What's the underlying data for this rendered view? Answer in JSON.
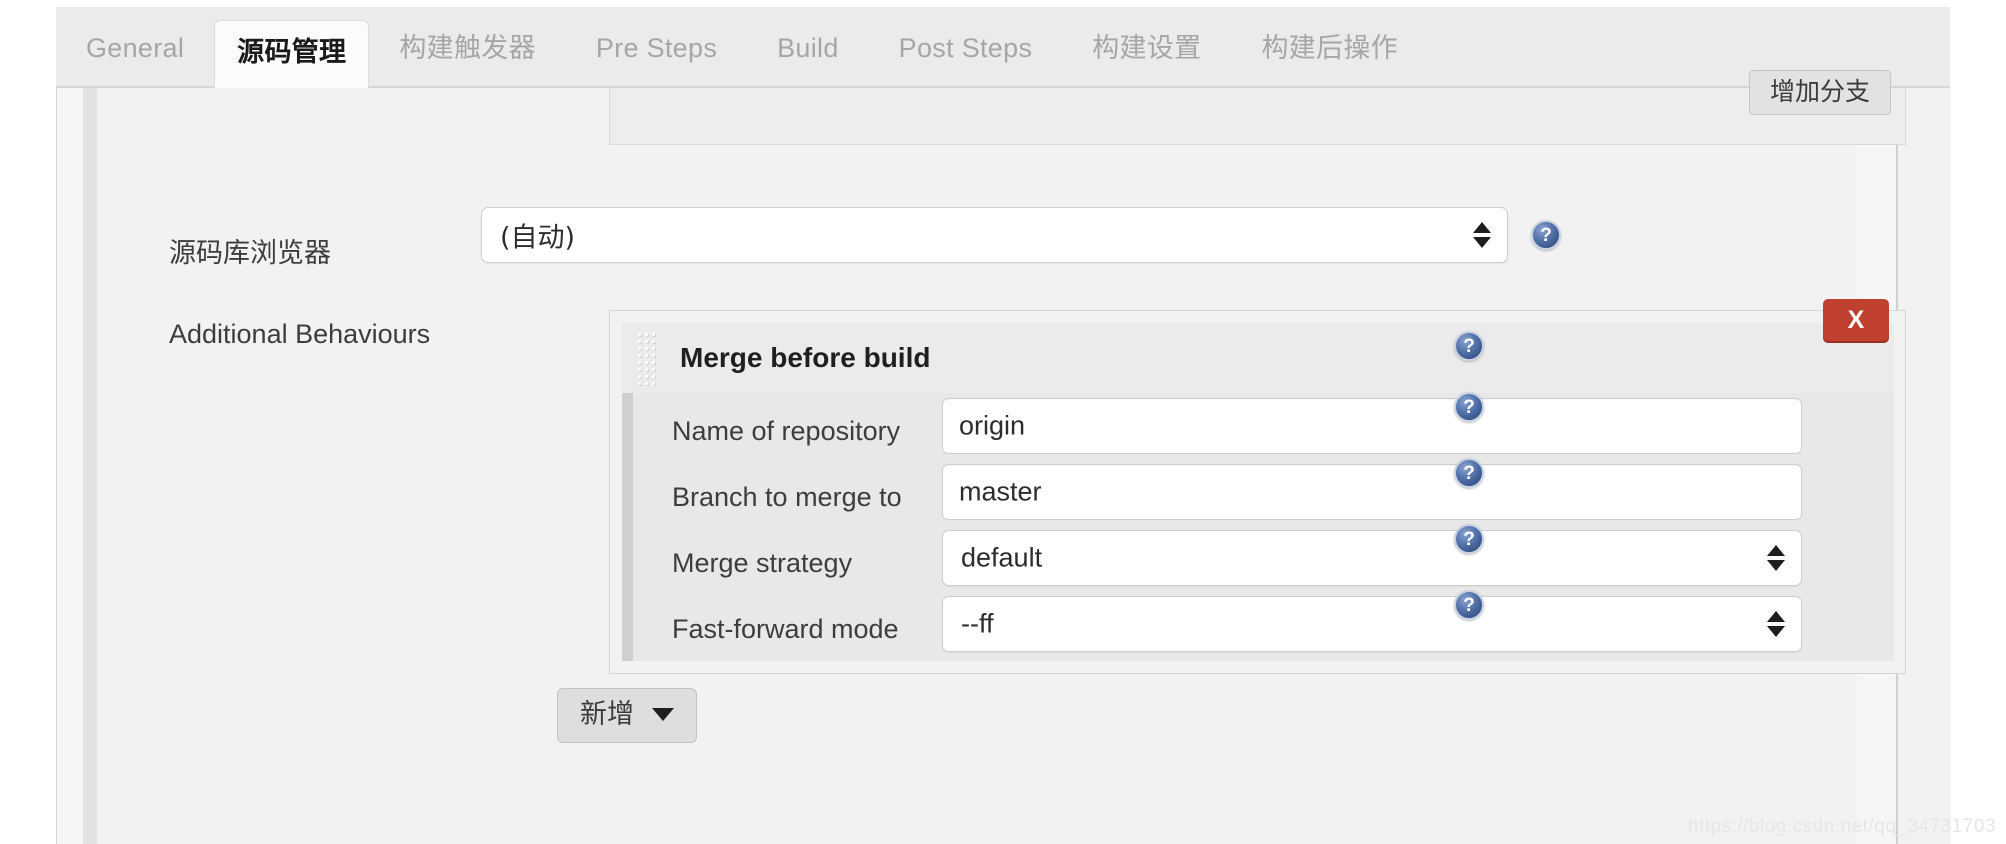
{
  "tabs": [
    {
      "label": "General",
      "active": false,
      "cjk": false
    },
    {
      "label": "源码管理",
      "active": true,
      "cjk": true
    },
    {
      "label": "构建触发器",
      "active": false,
      "cjk": true
    },
    {
      "label": "Pre Steps",
      "active": false,
      "cjk": false
    },
    {
      "label": "Build",
      "active": false,
      "cjk": false
    },
    {
      "label": "Post Steps",
      "active": false,
      "cjk": false
    },
    {
      "label": "构建设置",
      "active": false,
      "cjk": true
    },
    {
      "label": "构建后操作",
      "active": false,
      "cjk": true
    }
  ],
  "branch_section": {
    "add_branch_label": "增加分支"
  },
  "repo_browser": {
    "label": "源码库浏览器",
    "value": "(自动)"
  },
  "additional_behaviours": {
    "label": "Additional Behaviours",
    "panel_title": "Merge before build",
    "remove_label": "X",
    "fields": [
      {
        "label": "Name of repository",
        "value": "origin",
        "type": "text"
      },
      {
        "label": "Branch to merge to",
        "value": "master",
        "type": "text"
      },
      {
        "label": "Merge strategy",
        "value": "default",
        "type": "select"
      },
      {
        "label": "Fast-forward mode",
        "value": "--ff",
        "type": "select"
      }
    ],
    "add_button_label": "新增"
  },
  "help_icon_glyph": "?",
  "watermark": "https://blog.csdn.net/qq_34731703",
  "colors": {
    "accent_remove": "#c0402f",
    "help_blue": "#3d5a91",
    "page_bg": "#f2f2f2",
    "tabbar_bg": "#ebebeb"
  }
}
